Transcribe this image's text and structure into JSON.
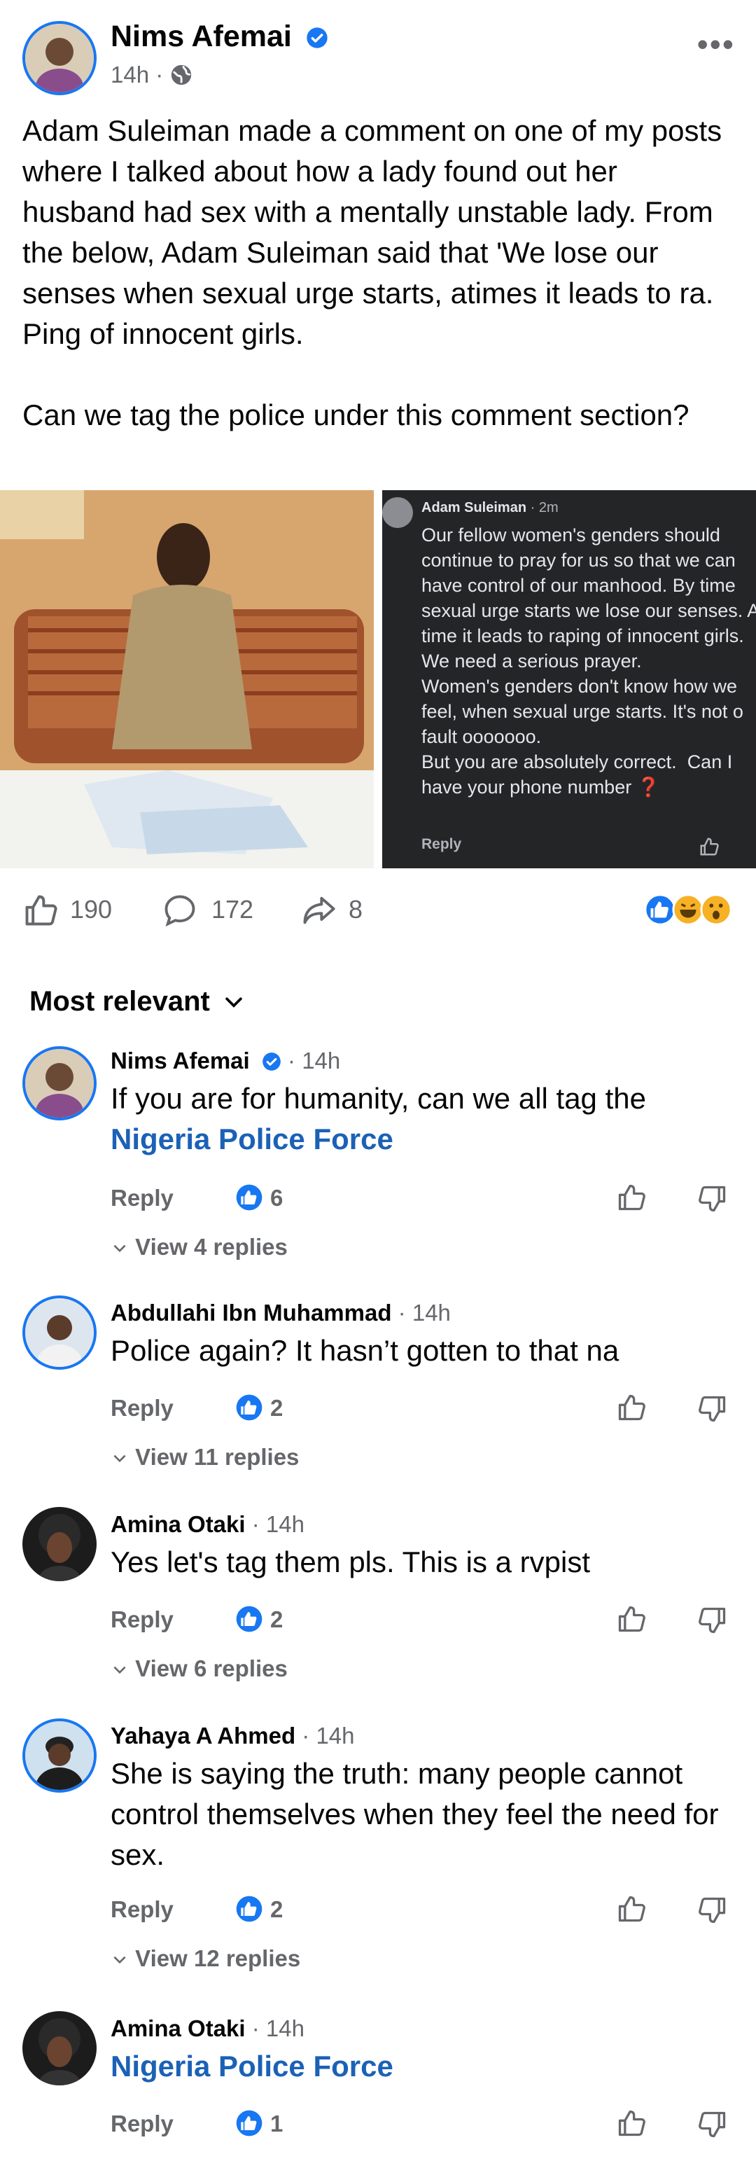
{
  "post": {
    "author": "Nims Afemai",
    "time": "14h",
    "text": "Adam Suleiman made a comment on one of my posts where I talked about how a lady found out her husband had sex with a mentally unstable lady. From the below, Adam Suleiman said that 'We lose our senses when sexual urge starts, atimes it leads to ra. Ping of innocent girls.\n\nCan we tag the police under this comment section?",
    "screenshot": {
      "name": "Adam Suleiman",
      "time": "2m",
      "text": "Our fellow women's genders should continue to pray for us so that we can have control of our manhood. By time sexual urge starts we lose our senses. At time it leads to raping of innocent girls.\nWe need a serious prayer.\nWomen's genders don't know how we feel, when sexual urge starts. It's not o fault ooooooo.\nBut you are absolutely correct.  Can I have your phone number ❓",
      "reply": "Reply"
    },
    "likes": "190",
    "comments": "172",
    "shares": "8"
  },
  "sort_label": "Most relevant",
  "comments": [
    {
      "name": "Nims Afemai",
      "verified": true,
      "time": "14h",
      "text": "If you are for humanity, can we all tag the",
      "link": "Nigeria Police Force",
      "reply": "Reply",
      "likes": "6",
      "view": "View 4 replies"
    },
    {
      "name": "Abdullahi Ibn Muhammad",
      "time": "14h",
      "text": "Police again? It hasn’t gotten to that na",
      "reply": "Reply",
      "likes": "2",
      "view": "View 11 replies"
    },
    {
      "name": "Amina Otaki",
      "time": "14h",
      "text": "Yes let's tag them pls. This is a rvpist",
      "reply": "Reply",
      "likes": "2",
      "view": "View 6 replies"
    },
    {
      "name": "Yahaya A Ahmed",
      "time": "14h",
      "text": "She is saying the truth: many people cannot control themselves when they feel the need for sex.",
      "reply": "Reply",
      "likes": "2",
      "view": "View 12 replies"
    },
    {
      "name": "Amina Otaki",
      "time": "14h",
      "link": "Nigeria Police Force",
      "reply": "Reply",
      "likes": "1"
    }
  ],
  "colors": {
    "accent": "#1877f2",
    "link": "#1b61b6",
    "secondary_text": "#65676b"
  }
}
